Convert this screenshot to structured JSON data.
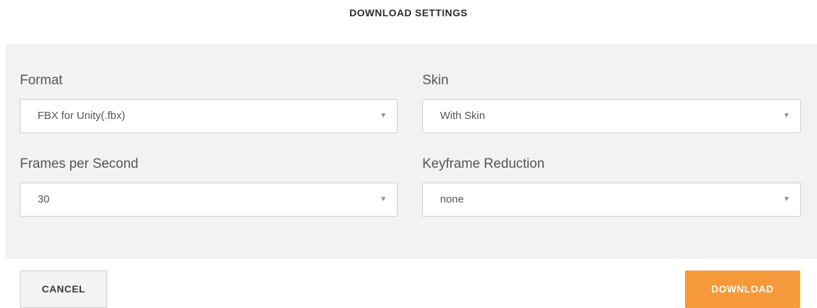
{
  "dialog": {
    "title": "DOWNLOAD SETTINGS"
  },
  "fields": {
    "format": {
      "label": "Format",
      "value": "FBX for Unity(.fbx)"
    },
    "skin": {
      "label": "Skin",
      "value": "With Skin"
    },
    "fps": {
      "label": "Frames per Second",
      "value": "30"
    },
    "keyframe": {
      "label": "Keyframe Reduction",
      "value": "none"
    }
  },
  "icons": {
    "caret": "▼"
  },
  "buttons": {
    "cancel": "CANCEL",
    "download": "DOWNLOAD"
  },
  "colors": {
    "accent": "#f6993a",
    "panel_bg": "#f2f2f2"
  }
}
